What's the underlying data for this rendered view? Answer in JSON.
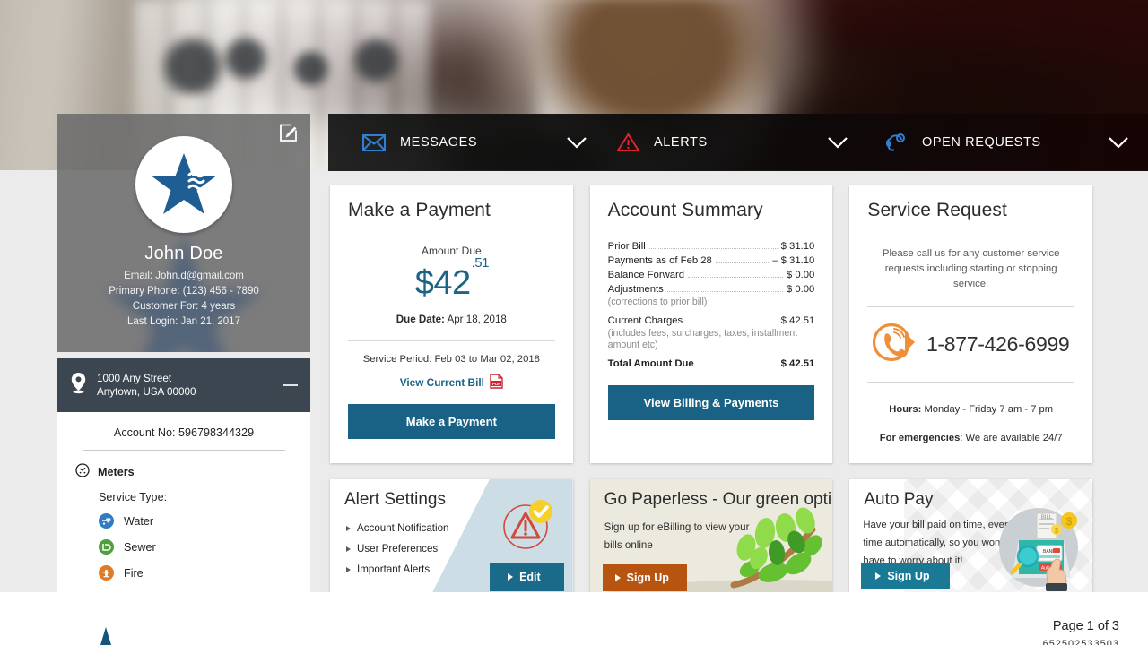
{
  "nav": {
    "items": [
      {
        "label": "MESSAGES",
        "icon": "envelope-icon"
      },
      {
        "label": "ALERTS",
        "icon": "warning-triangle-icon"
      },
      {
        "label": "OPEN REQUESTS",
        "icon": "headset-gear-icon"
      }
    ],
    "caret": "chevron-down-icon"
  },
  "profile": {
    "name": "John Doe",
    "email": "Email: John.d@gmail.com",
    "phone": "Primary Phone: (123) 456 - 7890",
    "customer_for": "Customer For: 4 years",
    "last_login": "Last Login: Jan 21, 2017",
    "edit_icon": "edit-pencil-icon"
  },
  "address": {
    "line1": "1000 Any Street",
    "line2": "Anytown, USA 00000",
    "collapse": "–"
  },
  "account": {
    "number_label": "Account No: 596798344329",
    "meters_label": "Meters",
    "service_type_label": "Service Type:",
    "services": [
      {
        "label": "Water",
        "color": "#2f7cc4",
        "icon": "water-tap-icon"
      },
      {
        "label": "Sewer",
        "color": "#4f9f3f",
        "icon": "sewer-icon"
      },
      {
        "label": "Fire",
        "color": "#e07b28",
        "icon": "fire-hydrant-icon"
      }
    ]
  },
  "make_payment": {
    "title": "Make a Payment",
    "amount_due_label": "Amount Due",
    "amount_dollars": "$42",
    "amount_cents": ".51",
    "due_date_label": "Due Date:",
    "due_date": "Apr 18, 2018",
    "service_period": "Service Period: Feb 03 to Mar 02, 2018",
    "view_bill_link": "View Current Bill",
    "pdf_badge": "PDF",
    "button": "Make a Payment"
  },
  "account_summary": {
    "title": "Account Summary",
    "rows": [
      {
        "name": "Prior Bill",
        "value": "$ 31.10",
        "bold": false,
        "note": ""
      },
      {
        "name": "Payments as of Feb 28",
        "value": "– $ 31.10",
        "bold": false,
        "note": ""
      },
      {
        "name": "Balance Forward",
        "value": "$ 0.00",
        "bold": false,
        "note": ""
      },
      {
        "name": "Adjustments",
        "value": "$ 0.00",
        "bold": false,
        "note": "(corrections to prior bill)"
      },
      {
        "name": "Current Charges",
        "value": "$ 42.51",
        "bold": false,
        "note": "(includes fees, surcharges, taxes, installment amount etc)"
      },
      {
        "name": "Total Amount Due",
        "value": "$ 42.51",
        "bold": true,
        "note": ""
      }
    ],
    "button": "View Billing & Payments"
  },
  "service_request": {
    "title": "Service Request",
    "description": "Please call us for any customer service requests including starting or stopping service.",
    "phone": "1-877-426-6999",
    "phone_icon": "phone-ringing-icon",
    "hours_label": "Hours:",
    "hours_value": "Monday - Friday 7 am - 7 pm",
    "emergency_label": "For emergencies",
    "emergency_value": ": We are available 24/7"
  },
  "alert_settings": {
    "title": "Alert Settings",
    "items": [
      "Account Notification",
      "User Preferences",
      "Important Alerts"
    ],
    "button": "Edit",
    "badge_icon": "alert-check-icon"
  },
  "paperless": {
    "title": "Go Paperless - Our green option",
    "subtitle": "Sign up for eBilling to view your bills online",
    "button": "Sign Up",
    "art_icon": "green-leaves-icon"
  },
  "auto_pay": {
    "title": "Auto Pay",
    "subtitle": "Have your bill paid on time, every time automatically, so you won't have to worry about it!",
    "button": "Sign Up",
    "art_icon": "autopay-laptop-icon"
  },
  "footer": {
    "page_indicator": "Page 1 of 3",
    "doc_number": "652502533503"
  },
  "colors": {
    "accent_blue": "#1a6285",
    "dark_nav": "#3b4650",
    "orange": "#b75410",
    "teal": "#1a7a96"
  }
}
